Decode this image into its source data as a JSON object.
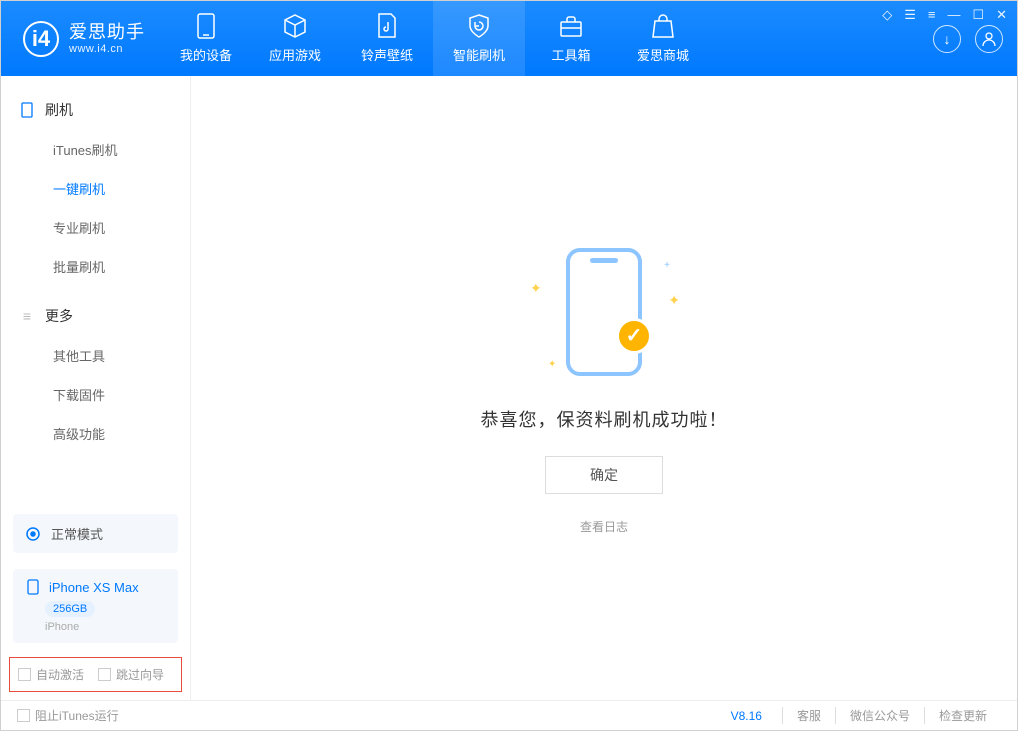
{
  "app": {
    "name": "爱思助手",
    "domain": "www.i4.cn"
  },
  "nav": {
    "items": [
      {
        "label": "我的设备"
      },
      {
        "label": "应用游戏"
      },
      {
        "label": "铃声壁纸"
      },
      {
        "label": "智能刷机"
      },
      {
        "label": "工具箱"
      },
      {
        "label": "爱思商城"
      }
    ]
  },
  "sidebar": {
    "group1": {
      "title": "刷机",
      "items": [
        {
          "label": "iTunes刷机"
        },
        {
          "label": "一键刷机"
        },
        {
          "label": "专业刷机"
        },
        {
          "label": "批量刷机"
        }
      ]
    },
    "group2": {
      "title": "更多",
      "items": [
        {
          "label": "其他工具"
        },
        {
          "label": "下载固件"
        },
        {
          "label": "高级功能"
        }
      ]
    },
    "mode": "正常模式",
    "device": {
      "name": "iPhone XS Max",
      "capacity": "256GB",
      "type": "iPhone"
    },
    "options": {
      "auto_activate": "自动激活",
      "skip_guide": "跳过向导"
    }
  },
  "main": {
    "success_text": "恭喜您，保资料刷机成功啦！",
    "ok_label": "确定",
    "view_log": "查看日志"
  },
  "footer": {
    "block_itunes": "阻止iTunes运行",
    "version": "V8.16",
    "links": [
      "客服",
      "微信公众号",
      "检查更新"
    ]
  }
}
